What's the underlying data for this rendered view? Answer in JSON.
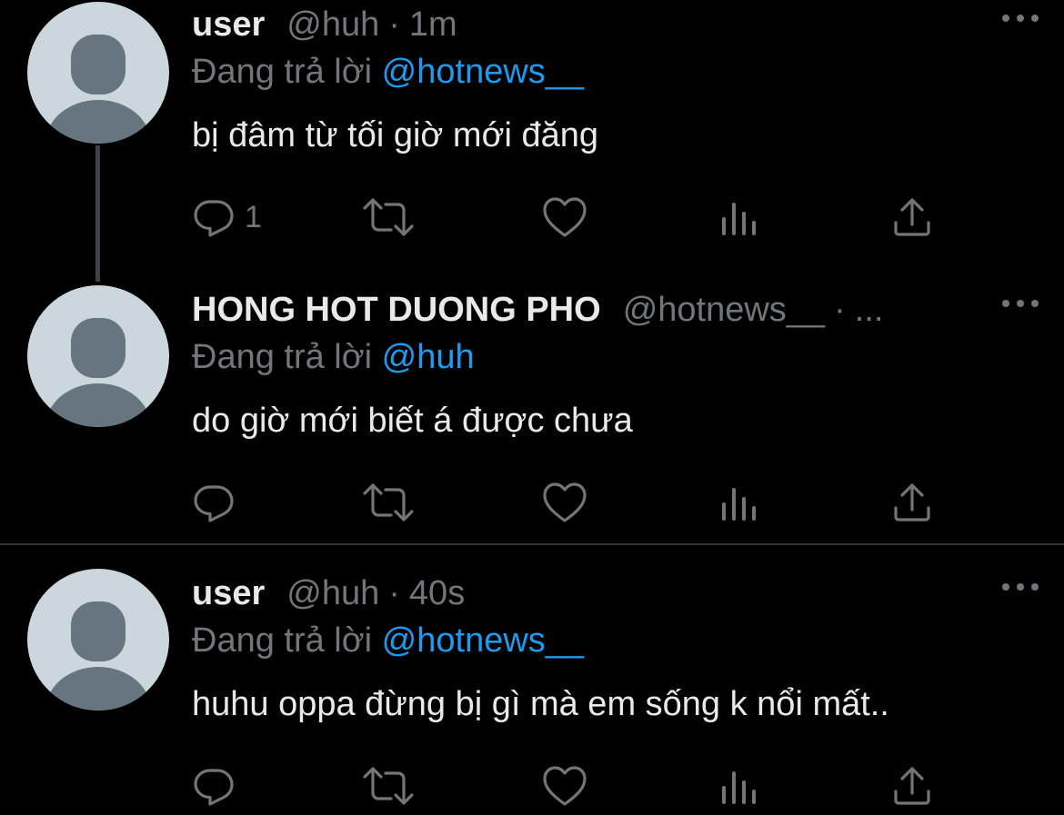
{
  "colors": {
    "background": "#000000",
    "primary_text": "#e7e9ea",
    "secondary_text": "#71767b",
    "accent": "#1d9bf0",
    "avatar_bg": "#ccd6dd",
    "avatar_fg": "#66757f"
  },
  "tweets": [
    {
      "display_name": "user",
      "handle": "@huh",
      "separator": "·",
      "time": "1m",
      "reply_prefix": "Đang trả lời",
      "reply_to": "@hotnews__",
      "text": "bị đâm từ tối giờ mới đăng",
      "reply_count": "1",
      "icons": [
        "reply-icon",
        "retweet-icon",
        "like-icon",
        "analytics-icon",
        "share-icon"
      ]
    },
    {
      "display_name": "HONG HOT DUONG PHO",
      "handle": "@hotnews__",
      "separator": "·",
      "time": "...",
      "reply_prefix": "Đang trả lời",
      "reply_to": "@huh",
      "text": "do giờ mới biết á được chưa",
      "reply_count": "",
      "icons": [
        "reply-icon",
        "retweet-icon",
        "like-icon",
        "analytics-icon",
        "share-icon"
      ]
    },
    {
      "display_name": "user",
      "handle": "@huh",
      "separator": "·",
      "time": "40s",
      "reply_prefix": "Đang trả lời",
      "reply_to": "@hotnews__",
      "text": "huhu oppa đừng bị gì mà em sống k nổi mất..",
      "reply_count": "",
      "icons": [
        "reply-icon",
        "retweet-icon",
        "like-icon",
        "analytics-icon",
        "share-icon"
      ]
    }
  ]
}
